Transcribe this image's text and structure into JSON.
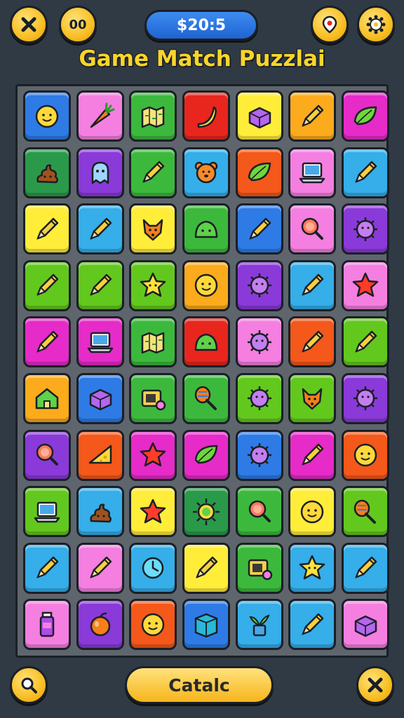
{
  "header": {
    "left_button_1_icon": "close-icon",
    "left_button_2_label": "00",
    "score_label": "$20:5",
    "right_button_1_icon": "hint-icon",
    "right_button_2_icon": "settings-gear-icon"
  },
  "title": "Game Match Puzzlai",
  "footer": {
    "left_button_icon": "search-icon",
    "center_button_label": "Catalc",
    "right_button_icon": "close-icon"
  },
  "colors": {
    "blue": "#2e7be6",
    "pink": "#f47fe0",
    "green": "#3cb93c",
    "red": "#e8261e",
    "yellow": "#ffed3a",
    "orange": "#fbab1c",
    "purple": "#8a3ad8",
    "sky": "#35aee9",
    "magenta": "#e62bc8",
    "lime": "#63c81e",
    "deeporange": "#f4581a",
    "darkgreen": "#2a9a4a"
  },
  "grid": [
    [
      {
        "c": "blue",
        "i": "smiley-icon"
      },
      {
        "c": "pink",
        "i": "carrot-icon"
      },
      {
        "c": "green",
        "i": "map-icon"
      },
      {
        "c": "red",
        "i": "banana-icon"
      },
      {
        "c": "yellow",
        "i": "box-icon"
      },
      {
        "c": "orange",
        "i": "pencil-icon"
      },
      {
        "c": "magenta",
        "i": "leaf-icon"
      }
    ],
    [
      {
        "c": "darkgreen",
        "i": "poop-icon"
      },
      {
        "c": "purple",
        "i": "ghost-icon"
      },
      {
        "c": "green",
        "i": "pencil-icon"
      },
      {
        "c": "sky",
        "i": "bear-icon"
      },
      {
        "c": "deeporange",
        "i": "leaf-icon"
      },
      {
        "c": "pink",
        "i": "laptop-icon"
      },
      {
        "c": "sky",
        "i": "pencil-icon"
      }
    ],
    [
      {
        "c": "yellow",
        "i": "pencil-icon"
      },
      {
        "c": "sky",
        "i": "pencil-icon"
      },
      {
        "c": "yellow",
        "i": "fox-icon"
      },
      {
        "c": "green",
        "i": "slime-icon"
      },
      {
        "c": "blue",
        "i": "pencil-icon"
      },
      {
        "c": "pink",
        "i": "magnifier-icon"
      },
      {
        "c": "purple",
        "i": "virus-icon"
      }
    ],
    [
      {
        "c": "lime",
        "i": "pencil-icon"
      },
      {
        "c": "lime",
        "i": "pencil-icon"
      },
      {
        "c": "lime",
        "i": "star-face-icon"
      },
      {
        "c": "orange",
        "i": "smiley-icon"
      },
      {
        "c": "purple",
        "i": "virus-icon"
      },
      {
        "c": "sky",
        "i": "pencil-icon"
      },
      {
        "c": "pink",
        "i": "star-icon"
      }
    ],
    [
      {
        "c": "magenta",
        "i": "pencil-icon"
      },
      {
        "c": "magenta",
        "i": "laptop-icon"
      },
      {
        "c": "green",
        "i": "map-icon"
      },
      {
        "c": "red",
        "i": "slime-icon"
      },
      {
        "c": "pink",
        "i": "virus-icon"
      },
      {
        "c": "deeporange",
        "i": "pencil-icon"
      },
      {
        "c": "lime",
        "i": "pencil-icon"
      }
    ],
    [
      {
        "c": "orange",
        "i": "house-icon"
      },
      {
        "c": "blue",
        "i": "box-icon"
      },
      {
        "c": "green",
        "i": "camera-icon"
      },
      {
        "c": "green",
        "i": "maraca-icon"
      },
      {
        "c": "lime",
        "i": "virus-icon"
      },
      {
        "c": "lime",
        "i": "fox-icon"
      },
      {
        "c": "purple",
        "i": "virus-icon"
      }
    ],
    [
      {
        "c": "purple",
        "i": "magnifier-icon"
      },
      {
        "c": "deeporange",
        "i": "cheese-icon"
      },
      {
        "c": "magenta",
        "i": "star-icon"
      },
      {
        "c": "magenta",
        "i": "leaf-icon"
      },
      {
        "c": "blue",
        "i": "virus-icon"
      },
      {
        "c": "magenta",
        "i": "pencil-icon"
      },
      {
        "c": "deeporange",
        "i": "smiley-icon"
      }
    ],
    [
      {
        "c": "lime",
        "i": "laptop-icon"
      },
      {
        "c": "sky",
        "i": "poop-icon"
      },
      {
        "c": "yellow",
        "i": "star-icon"
      },
      {
        "c": "darkgreen",
        "i": "sun-icon"
      },
      {
        "c": "green",
        "i": "magnifier-icon"
      },
      {
        "c": "yellow",
        "i": "smiley-icon"
      },
      {
        "c": "lime",
        "i": "maraca-icon"
      }
    ],
    [
      {
        "c": "sky",
        "i": "pencil-icon"
      },
      {
        "c": "pink",
        "i": "pencil-icon"
      },
      {
        "c": "sky",
        "i": "clock-icon"
      },
      {
        "c": "yellow",
        "i": "pencil-icon"
      },
      {
        "c": "green",
        "i": "camera-icon"
      },
      {
        "c": "sky",
        "i": "star-face-icon"
      },
      {
        "c": "sky",
        "i": "pencil-icon"
      }
    ],
    [
      {
        "c": "pink",
        "i": "bottle-icon"
      },
      {
        "c": "purple",
        "i": "fruit-icon"
      },
      {
        "c": "deeporange",
        "i": "smiley-icon"
      },
      {
        "c": "blue",
        "i": "book-icon"
      },
      {
        "c": "sky",
        "i": "plant-icon"
      },
      {
        "c": "sky",
        "i": "pencil-icon"
      },
      {
        "c": "pink",
        "i": "box-icon"
      }
    ]
  ]
}
